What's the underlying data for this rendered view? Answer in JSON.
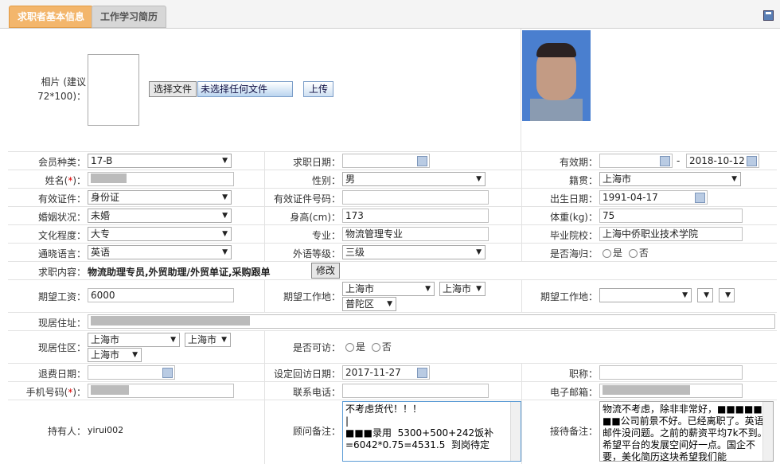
{
  "tabs": [
    {
      "label": "求职者基本信息"
    },
    {
      "label": "工作学习简历"
    }
  ],
  "photo": {
    "label": "相片 (建议72*100)：",
    "choose_file": "选择文件",
    "no_file": "未选择任何文件",
    "upload": "上传"
  },
  "fields": {
    "member_type_label": "会员种类：",
    "member_type": "17-B",
    "apply_date_label": "求职日期：",
    "apply_date": "",
    "valid_label": "有效期：",
    "valid_from": "",
    "valid_sep": "-",
    "valid_to": "2018-10-12",
    "name_label": "姓名(*)：",
    "name": "",
    "gender_label": "性别：",
    "gender": "男",
    "origin_label": "籍贯：",
    "origin": "上海市",
    "id_type_label": "有效证件：",
    "id_type": "身份证",
    "id_no_label": "有效证件号码：",
    "id_no": "",
    "birth_label": "出生日期：",
    "birth": "1991-04-17",
    "marital_label": "婚姻状况：",
    "marital": "未婚",
    "height_label": "身高(cm)：",
    "height": "173",
    "weight_label": "体重(kg)：",
    "weight": "75",
    "education_label": "文化程度：",
    "education": "大专",
    "major_label": "专业：",
    "major": "物流管理专业",
    "school_label": "毕业院校：",
    "school": "上海中侨职业技术学院",
    "language_label": "通晓语言：",
    "language": "英语",
    "lang_level_label": "外语等级：",
    "lang_level": "三级",
    "overseas_label": "是否海归：",
    "yes": "是",
    "no": "否",
    "job_content_label": "求职内容：",
    "job_content": "物流助理专员,外贸助理/外贸单证,采购跟单",
    "modify": "修改",
    "salary_label": "期望工资：",
    "salary": "6000",
    "exp_loc_label": "期望工作地：",
    "exp_loc1": "上海市",
    "exp_loc2": "上海市",
    "exp_loc3": "普陀区",
    "exp_loc2_label": "期望工作地：",
    "address_label": "现居住址：",
    "district_label": "现居住区：",
    "district1": "上海市",
    "district2": "上海市",
    "district3": "上海市",
    "callback_label": "是否可访：",
    "refund_label": "退费日期：",
    "refund": "",
    "revisit_label": "设定回访日期：",
    "revisit": "2017-11-27",
    "title_label": "职称：",
    "title": "",
    "phone_label": "手机号码(*)：",
    "tel_label": "联系电话：",
    "tel": "",
    "email_label": "电子邮箱：",
    "holder_label": "持有人：",
    "holder": "yirui002",
    "advisor_label": "顾问备注：",
    "advisor_note": "不考虑货代！！！\n|\n■■■录用  5300+500+242饭补\n=6042*0.75=4531.5  到岗待定",
    "reception_label": "接待备注：",
    "reception_note": "物流不考虑，除非非常好，■■■■■\n■■公司前景不好。已经离职了。英语邮件没问题。之前的薪资平均7k不到。希望平台的发展空间好一点。国企不要，美化简历这块希望我们能"
  }
}
